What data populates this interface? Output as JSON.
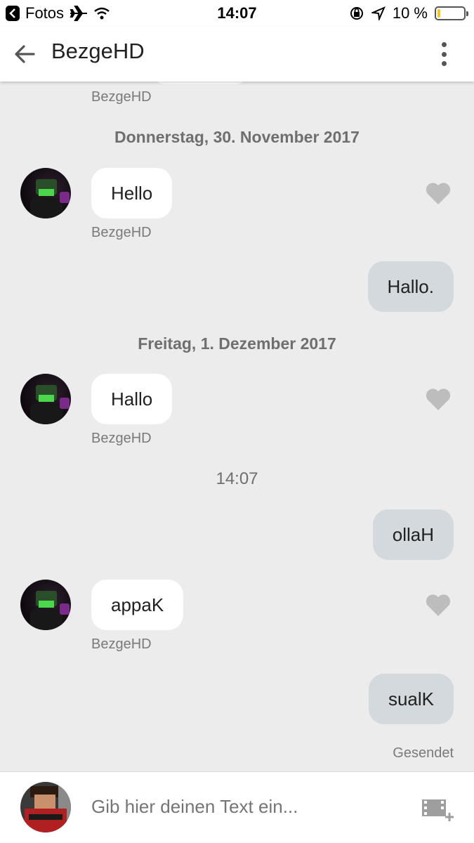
{
  "status_bar": {
    "back_app": "Fotos",
    "time": "14:07",
    "battery": "10 %",
    "battery_level": 0.1
  },
  "header": {
    "title": "BezgeHD"
  },
  "messages": {
    "prev_sender": "BezgeHD",
    "date1": "Donnerstag, 30. November 2017",
    "m1": {
      "text": "Hello",
      "sender": "BezgeHD"
    },
    "m2": {
      "text": "Hallo."
    },
    "date2": "Freitag, 1. Dezember 2017",
    "m3": {
      "text": "Hallo",
      "sender": "BezgeHD"
    },
    "time_marker": "14:07",
    "m4": {
      "text": "ollaH"
    },
    "m5": {
      "text": "appaK",
      "sender": "BezgeHD"
    },
    "m6": {
      "text": "sualK"
    },
    "status": "Gesendet"
  },
  "composer": {
    "placeholder": "Gib hier deinen Text ein..."
  },
  "colors": {
    "background": "#ececec",
    "incoming_bubble": "#ffffff",
    "outgoing_bubble": "#d3d9dc",
    "heart": "#bdbdbd"
  },
  "icons": [
    "back-chevron-icon",
    "airplane-icon",
    "wifi-icon",
    "rotation-lock-icon",
    "location-arrow-icon",
    "battery-icon",
    "back-arrow-icon",
    "more-vert-icon",
    "heart-icon",
    "media-add-icon"
  ]
}
